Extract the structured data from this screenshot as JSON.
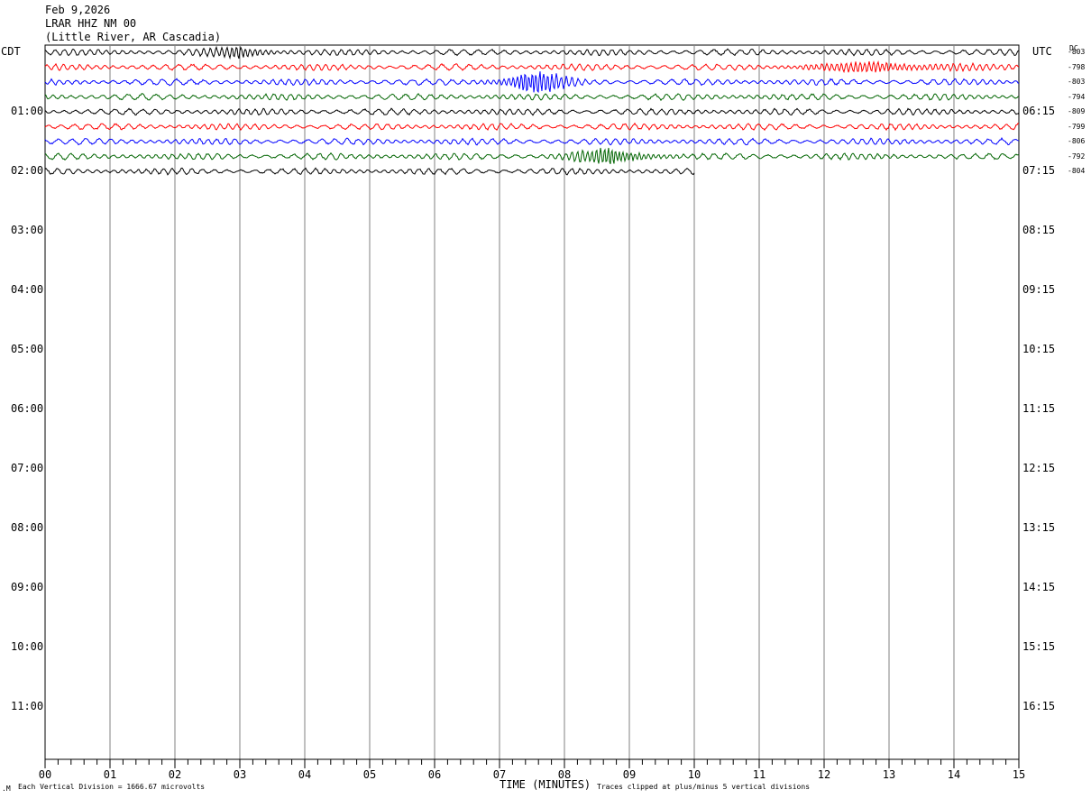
{
  "header": {
    "date": "Feb 9,2026",
    "station": "LRAR HHZ NM 00",
    "location": "(Little River, AR Cascadia)"
  },
  "left_tz": "CDT",
  "right_tz": "UTC",
  "dc_label": "DC",
  "left_times": [
    "01:00",
    "02:00",
    "03:00",
    "04:00",
    "05:00",
    "06:00",
    "07:00",
    "08:00",
    "09:00",
    "10:00",
    "11:00"
  ],
  "right_times": [
    "06:15",
    "07:15",
    "08:15",
    "09:15",
    "10:15",
    "11:15",
    "12:15",
    "13:15",
    "14:15",
    "15:15",
    "16:15"
  ],
  "dc_offsets": [
    "-803",
    "-798",
    "-803",
    "-794",
    "-809",
    "-799",
    "-806",
    "-792",
    "-804"
  ],
  "x_ticks": [
    "00",
    "01",
    "02",
    "03",
    "04",
    "05",
    "06",
    "07",
    "08",
    "09",
    "10",
    "11",
    "12",
    "13",
    "14",
    "15"
  ],
  "x_axis_label": "TIME (MINUTES)",
  "footer_left": "Each Vertical Division = 1666.67 microvolts",
  "footer_right": "Traces clipped at plus/minus 5 vertical divisions",
  "colors": {
    "trace_cycle": [
      "#000000",
      "#ff0000",
      "#0000ff",
      "#006400"
    ],
    "grid": "#808080"
  },
  "chart_data": {
    "type": "line",
    "xlabel": "TIME (MINUTES)",
    "xlim": [
      0,
      15
    ],
    "row_interval_minutes": 15,
    "rows": [
      {
        "index": 0,
        "color": "#000000",
        "dc": "-803",
        "end_minute": 15,
        "burst": {
          "start": 2,
          "end": 4,
          "amp": 1.4
        }
      },
      {
        "index": 1,
        "color": "#ff0000",
        "dc": "-798",
        "end_minute": 15,
        "burst": {
          "start": 11,
          "end": 15,
          "amp": 1.4
        }
      },
      {
        "index": 2,
        "color": "#0000ff",
        "dc": "-803",
        "end_minute": 15,
        "burst": {
          "start": 6.5,
          "end": 8.5,
          "amp": 4.0
        }
      },
      {
        "index": 3,
        "color": "#006400",
        "dc": "-794",
        "end_minute": 15,
        "burst": null
      },
      {
        "index": 4,
        "color": "#000000",
        "dc": "-809",
        "end_minute": 15,
        "burst": null
      },
      {
        "index": 5,
        "color": "#ff0000",
        "dc": "-799",
        "end_minute": 15,
        "burst": null
      },
      {
        "index": 6,
        "color": "#0000ff",
        "dc": "-806",
        "end_minute": 15,
        "burst": null
      },
      {
        "index": 7,
        "color": "#006400",
        "dc": "-792",
        "end_minute": 15,
        "burst": {
          "start": 7.5,
          "end": 10,
          "amp": 2.4
        }
      },
      {
        "index": 8,
        "color": "#000000",
        "dc": "-804",
        "end_minute": 10,
        "burst": null
      }
    ]
  }
}
